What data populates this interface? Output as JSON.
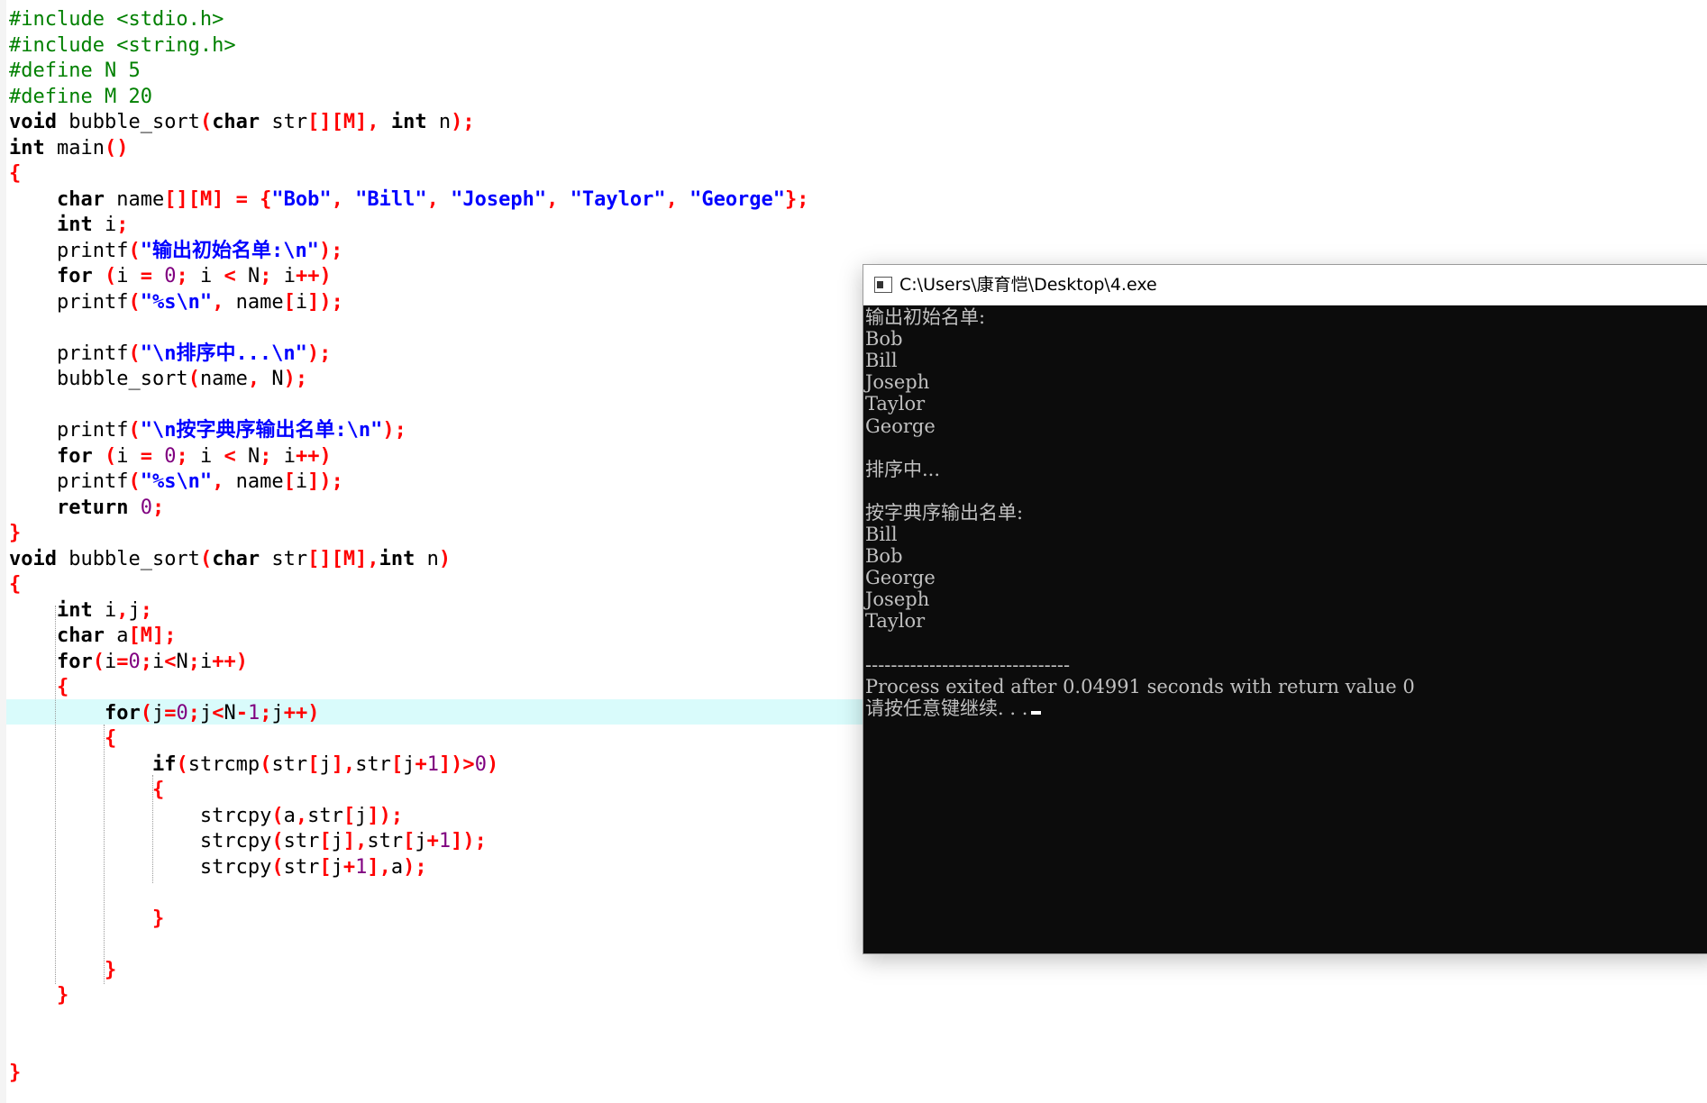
{
  "editor": {
    "lines": [
      [
        [
          "pp",
          "#include <stdio.h>"
        ]
      ],
      [
        [
          "pp",
          "#include <string.h>"
        ]
      ],
      [
        [
          "pp",
          "#define N 5"
        ]
      ],
      [
        [
          "pp",
          "#define M 20"
        ]
      ],
      [
        [
          "kw",
          "void"
        ],
        [
          "plain",
          " bubble_sort"
        ],
        [
          "pun",
          "("
        ],
        [
          "kw",
          "char"
        ],
        [
          "plain",
          " str"
        ],
        [
          "pun",
          "[][M],"
        ],
        [
          "plain",
          " "
        ],
        [
          "kw",
          "int"
        ],
        [
          "plain",
          " n"
        ],
        [
          "pun",
          ");"
        ]
      ],
      [
        [
          "kw",
          "int"
        ],
        [
          "plain",
          " main"
        ],
        [
          "pun",
          "()"
        ]
      ],
      [
        [
          "pun",
          "{"
        ]
      ],
      [
        [
          "plain",
          "    "
        ],
        [
          "kw",
          "char"
        ],
        [
          "plain",
          " name"
        ],
        [
          "pun",
          "[][M] = {"
        ],
        [
          "str",
          "\"Bob\""
        ],
        [
          "pun",
          ", "
        ],
        [
          "str",
          "\"Bill\""
        ],
        [
          "pun",
          ", "
        ],
        [
          "str",
          "\"Joseph\""
        ],
        [
          "pun",
          ", "
        ],
        [
          "str",
          "\"Taylor\""
        ],
        [
          "pun",
          ", "
        ],
        [
          "str",
          "\"George\""
        ],
        [
          "pun",
          "};"
        ]
      ],
      [
        [
          "plain",
          "    "
        ],
        [
          "kw",
          "int"
        ],
        [
          "plain",
          " i"
        ],
        [
          "pun",
          ";"
        ]
      ],
      [
        [
          "plain",
          "    printf"
        ],
        [
          "pun",
          "("
        ],
        [
          "str",
          "\"输出初始名单:\\n\""
        ],
        [
          "pun",
          ");"
        ]
      ],
      [
        [
          "plain",
          "    "
        ],
        [
          "kw",
          "for"
        ],
        [
          "plain",
          " "
        ],
        [
          "pun",
          "("
        ],
        [
          "plain",
          "i "
        ],
        [
          "pun",
          "="
        ],
        [
          "plain",
          " "
        ],
        [
          "num",
          "0"
        ],
        [
          "pun",
          ";"
        ],
        [
          "plain",
          " i "
        ],
        [
          "pun",
          "<"
        ],
        [
          "plain",
          " N"
        ],
        [
          "pun",
          ";"
        ],
        [
          "plain",
          " i"
        ],
        [
          "pun",
          "++)"
        ]
      ],
      [
        [
          "plain",
          "    printf"
        ],
        [
          "pun",
          "("
        ],
        [
          "str",
          "\"%s\\n\""
        ],
        [
          "pun",
          ","
        ],
        [
          "plain",
          " name"
        ],
        [
          "pun",
          "["
        ],
        [
          "plain",
          "i"
        ],
        [
          "pun",
          "]);"
        ]
      ],
      [],
      [
        [
          "plain",
          "    printf"
        ],
        [
          "pun",
          "("
        ],
        [
          "str",
          "\"\\n排序中...\\n\""
        ],
        [
          "pun",
          ");"
        ]
      ],
      [
        [
          "plain",
          "    bubble_sort"
        ],
        [
          "pun",
          "("
        ],
        [
          "plain",
          "name"
        ],
        [
          "pun",
          ","
        ],
        [
          "plain",
          " N"
        ],
        [
          "pun",
          ");"
        ]
      ],
      [],
      [
        [
          "plain",
          "    printf"
        ],
        [
          "pun",
          "("
        ],
        [
          "str",
          "\"\\n按字典序输出名单:\\n\""
        ],
        [
          "pun",
          ");"
        ]
      ],
      [
        [
          "plain",
          "    "
        ],
        [
          "kw",
          "for"
        ],
        [
          "plain",
          " "
        ],
        [
          "pun",
          "("
        ],
        [
          "plain",
          "i "
        ],
        [
          "pun",
          "="
        ],
        [
          "plain",
          " "
        ],
        [
          "num",
          "0"
        ],
        [
          "pun",
          ";"
        ],
        [
          "plain",
          " i "
        ],
        [
          "pun",
          "<"
        ],
        [
          "plain",
          " N"
        ],
        [
          "pun",
          ";"
        ],
        [
          "plain",
          " i"
        ],
        [
          "pun",
          "++)"
        ]
      ],
      [
        [
          "plain",
          "    printf"
        ],
        [
          "pun",
          "("
        ],
        [
          "str",
          "\"%s\\n\""
        ],
        [
          "pun",
          ","
        ],
        [
          "plain",
          " name"
        ],
        [
          "pun",
          "["
        ],
        [
          "plain",
          "i"
        ],
        [
          "pun",
          "]);"
        ]
      ],
      [
        [
          "plain",
          "    "
        ],
        [
          "kw",
          "return"
        ],
        [
          "plain",
          " "
        ],
        [
          "num",
          "0"
        ],
        [
          "pun",
          ";"
        ]
      ],
      [
        [
          "pun",
          "}"
        ]
      ],
      [
        [
          "kw",
          "void"
        ],
        [
          "plain",
          " bubble_sort"
        ],
        [
          "pun",
          "("
        ],
        [
          "kw",
          "char"
        ],
        [
          "plain",
          " str"
        ],
        [
          "pun",
          "[][M],"
        ],
        [
          "kw",
          "int"
        ],
        [
          "plain",
          " n"
        ],
        [
          "pun",
          ")"
        ]
      ],
      [
        [
          "pun",
          "{"
        ]
      ],
      [
        [
          "plain",
          "    "
        ],
        [
          "kw",
          "int"
        ],
        [
          "plain",
          " i"
        ],
        [
          "pun",
          ","
        ],
        [
          "plain",
          "j"
        ],
        [
          "pun",
          ";"
        ]
      ],
      [
        [
          "plain",
          "    "
        ],
        [
          "kw",
          "char"
        ],
        [
          "plain",
          " a"
        ],
        [
          "pun",
          "[M];"
        ]
      ],
      [
        [
          "plain",
          "    "
        ],
        [
          "kw",
          "for"
        ],
        [
          "pun",
          "("
        ],
        [
          "plain",
          "i"
        ],
        [
          "pun",
          "="
        ],
        [
          "num",
          "0"
        ],
        [
          "pun",
          ";"
        ],
        [
          "plain",
          "i"
        ],
        [
          "pun",
          "<"
        ],
        [
          "plain",
          "N"
        ],
        [
          "pun",
          ";"
        ],
        [
          "plain",
          "i"
        ],
        [
          "pun",
          "++)"
        ]
      ],
      [
        [
          "plain",
          "    "
        ],
        [
          "pun",
          "{"
        ]
      ],
      [
        [
          "plain",
          "        "
        ],
        [
          "kw",
          "for"
        ],
        [
          "pun",
          "("
        ],
        [
          "plain",
          "j"
        ],
        [
          "pun",
          "="
        ],
        [
          "num",
          "0"
        ],
        [
          "pun",
          ";"
        ],
        [
          "plain",
          "j"
        ],
        [
          "pun",
          "<"
        ],
        [
          "plain",
          "N"
        ],
        [
          "pun",
          "-"
        ],
        [
          "num",
          "1"
        ],
        [
          "pun",
          ";"
        ],
        [
          "plain",
          "j"
        ],
        [
          "pun",
          "++)"
        ]
      ],
      [
        [
          "plain",
          "        "
        ],
        [
          "pun",
          "{"
        ]
      ],
      [
        [
          "plain",
          "            "
        ],
        [
          "kw",
          "if"
        ],
        [
          "pun",
          "("
        ],
        [
          "plain",
          "strcmp"
        ],
        [
          "pun",
          "("
        ],
        [
          "plain",
          "str"
        ],
        [
          "pun",
          "["
        ],
        [
          "plain",
          "j"
        ],
        [
          "pun",
          "],"
        ],
        [
          "plain",
          "str"
        ],
        [
          "pun",
          "["
        ],
        [
          "plain",
          "j"
        ],
        [
          "pun",
          "+"
        ],
        [
          "num",
          "1"
        ],
        [
          "pun",
          "])>"
        ],
        [
          "num",
          "0"
        ],
        [
          "pun",
          ")"
        ]
      ],
      [
        [
          "plain",
          "            "
        ],
        [
          "pun",
          "{"
        ]
      ],
      [
        [
          "plain",
          "                strcpy"
        ],
        [
          "pun",
          "("
        ],
        [
          "plain",
          "a"
        ],
        [
          "pun",
          ","
        ],
        [
          "plain",
          "str"
        ],
        [
          "pun",
          "["
        ],
        [
          "plain",
          "j"
        ],
        [
          "pun",
          "]);"
        ]
      ],
      [
        [
          "plain",
          "                strcpy"
        ],
        [
          "pun",
          "("
        ],
        [
          "plain",
          "str"
        ],
        [
          "pun",
          "["
        ],
        [
          "plain",
          "j"
        ],
        [
          "pun",
          "],"
        ],
        [
          "plain",
          "str"
        ],
        [
          "pun",
          "["
        ],
        [
          "plain",
          "j"
        ],
        [
          "pun",
          "+"
        ],
        [
          "num",
          "1"
        ],
        [
          "pun",
          "]);"
        ]
      ],
      [
        [
          "plain",
          "                strcpy"
        ],
        [
          "pun",
          "("
        ],
        [
          "plain",
          "str"
        ],
        [
          "pun",
          "["
        ],
        [
          "plain",
          "j"
        ],
        [
          "pun",
          "+"
        ],
        [
          "num",
          "1"
        ],
        [
          "pun",
          "],"
        ],
        [
          "plain",
          "a"
        ],
        [
          "pun",
          ");"
        ]
      ],
      [],
      [
        [
          "plain",
          "            "
        ],
        [
          "pun",
          "}"
        ]
      ],
      [],
      [
        [
          "plain",
          "        "
        ],
        [
          "pun",
          "}"
        ]
      ],
      [
        [
          "plain",
          "    "
        ],
        [
          "pun",
          "}"
        ]
      ],
      [],
      [],
      [
        [
          "pun",
          "}"
        ]
      ]
    ]
  },
  "console": {
    "title": "C:\\Users\\康育恺\\Desktop\\4.exe",
    "output": [
      "输出初始名单:",
      "Bob",
      "Bill",
      "Joseph",
      "Taylor",
      "George",
      "",
      "排序中...",
      "",
      "按字典序输出名单:",
      "Bill",
      "Bob",
      "George",
      "Joseph",
      "Taylor",
      "",
      "--------------------------------",
      "Process exited after 0.04991 seconds with return value 0",
      "请按任意键继续. . ."
    ],
    "icon": "console-app-icon"
  },
  "colors": {
    "keyword": "#000000",
    "preprocessor": "#008000",
    "punctuation": "#ff0000",
    "string": "#0000ff",
    "number": "#800080",
    "current_line": "#d9fbfb",
    "console_bg": "#0c0c0c",
    "console_text": "#c0c0c0"
  }
}
